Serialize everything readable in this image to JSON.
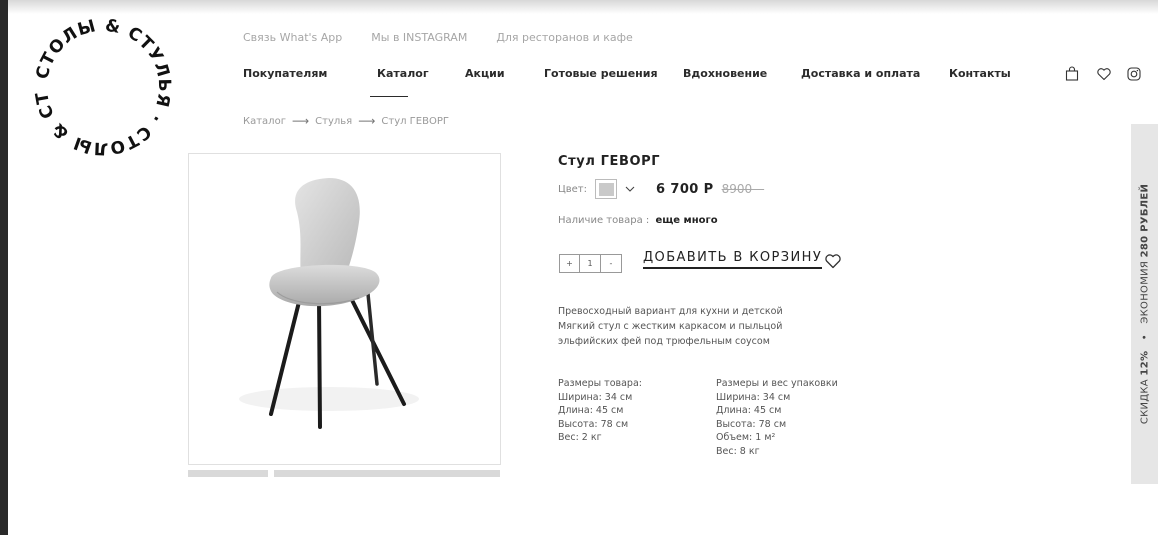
{
  "brand": {
    "logo_text": "СТОЛЫ & СТУЛЬЯ · СТОЛЫ & СТУЛЬЯ ·"
  },
  "topbar": {
    "links": [
      "Связь What's App",
      "Мы в INSTAGRAM",
      "Для ресторанов и кафе"
    ]
  },
  "nav": {
    "items": [
      "Покупателям",
      "Каталог",
      "Акции",
      "Готовые решения",
      "Вдохновение",
      "Доставка и оплата",
      "Контакты"
    ],
    "active": "Каталог"
  },
  "header_icons": [
    "bag-icon",
    "heart-icon",
    "instagram-icon"
  ],
  "breadcrumb": {
    "items": [
      "Каталог",
      "Стулья",
      "Стул ГЕВОРГ"
    ],
    "separator": "⟶"
  },
  "product": {
    "title": "Стул ГЕВОРГ",
    "color_label": "Цвет:",
    "swatch_color": "#c9c9c9",
    "price": "6 700 Р",
    "old_price": "8900—",
    "stock_label": "Наличие товара :",
    "stock_value": "еще много",
    "qty": {
      "plus": "+",
      "value": "1",
      "minus": "-"
    },
    "add_to_cart": "ДОБАВИТЬ В КОРЗИНУ",
    "description": [
      "Превосходный вариант для кухни и детской",
      "Мягкий стул с жестким каркасом и пыльцой",
      "эльфийских фей под трюфельным соусом"
    ],
    "specs": {
      "product_title": "Размеры товара:",
      "product_lines": [
        "Ширина: 34 см",
        "Длина: 45 см",
        "Высота: 78 см",
        "Вес: 2 кг"
      ],
      "package_title": "Размеры и вес упаковки",
      "package_lines": [
        "Ширина: 34 см",
        "Длина: 45 см",
        "Высота: 78 см",
        "Объем: 1 м²",
        "Вес: 8 кг"
      ]
    }
  },
  "side_banner": {
    "discount": "СКИДКА",
    "discount_value": "12%",
    "separator": "•",
    "economy": "ЭКОНОМИЯ",
    "economy_value": "280 РУБЛЕЙ"
  },
  "colors": {
    "text": "#222222",
    "muted": "#999999",
    "side_banner_bg": "#e6e6e6"
  }
}
